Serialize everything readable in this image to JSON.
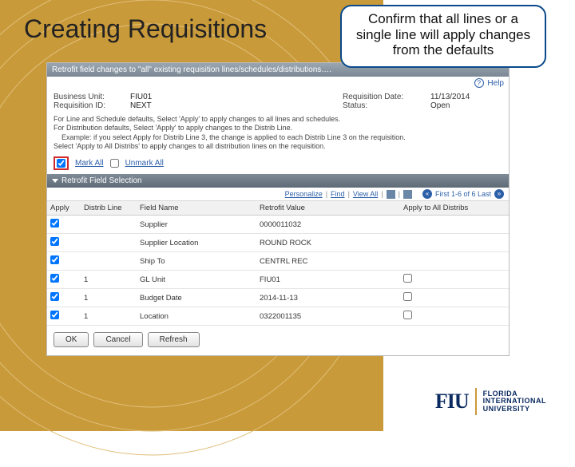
{
  "slide": {
    "title": "Creating Requisitions",
    "callout": "Confirm that all lines or a single line will apply changes from the defaults"
  },
  "app": {
    "window_title": "Retrofit field changes to \"all\" existing requisition lines/schedules/distributions….",
    "help_label": "Help",
    "meta": {
      "bu_label": "Business Unit:",
      "bu_value": "FIU01",
      "req_id_label": "Requisition ID:",
      "req_id_value": "NEXT",
      "req_date_label": "Requisition Date:",
      "req_date_value": "11/13/2014",
      "status_label": "Status:",
      "status_value": "Open"
    },
    "instructions": {
      "line1": "For Line and Schedule defaults, Select 'Apply' to apply changes to all lines and schedules.",
      "line2": "For Distribution defaults, Select 'Apply' to apply changes to the Distrib Line.",
      "line3": "Example: if you select Apply for Distrib Line 3, the change is applied to each Distrib Line 3 on the requisition.",
      "line4": "Select 'Apply to All Distribs' to apply changes to all distribution lines on the requisition."
    },
    "mark_all": "Mark All",
    "unmark_all": "Unmark All",
    "section_title": "Retrofit Field Selection",
    "toolbar": {
      "personalize": "Personalize",
      "find": "Find",
      "view_all": "View All",
      "pager": "First 1-6 of 6 Last"
    },
    "columns": {
      "apply": "Apply",
      "distrib": "Distrib Line",
      "field": "Field Name",
      "value": "Retrofit Value",
      "apply_all": "Apply to All Distribs"
    },
    "rows": [
      {
        "distrib": "",
        "field": "Supplier",
        "value": "0000011032",
        "apply_all": false
      },
      {
        "distrib": "",
        "field": "Supplier Location",
        "value": "ROUND ROCK",
        "apply_all": false
      },
      {
        "distrib": "",
        "field": "Ship To",
        "value": "CENTRL REC",
        "apply_all": false
      },
      {
        "distrib": "1",
        "field": "GL Unit",
        "value": "FIU01",
        "apply_all": true
      },
      {
        "distrib": "1",
        "field": "Budget Date",
        "value": "2014-11-13",
        "apply_all": true
      },
      {
        "distrib": "1",
        "field": "Location",
        "value": "0322001135",
        "apply_all": true
      }
    ],
    "buttons": {
      "ok": "OK",
      "cancel": "Cancel",
      "refresh": "Refresh"
    }
  },
  "logo": {
    "mark": "FIU",
    "l1": "FLORIDA",
    "l2": "INTERNATIONAL",
    "l3": "UNIVERSITY"
  }
}
